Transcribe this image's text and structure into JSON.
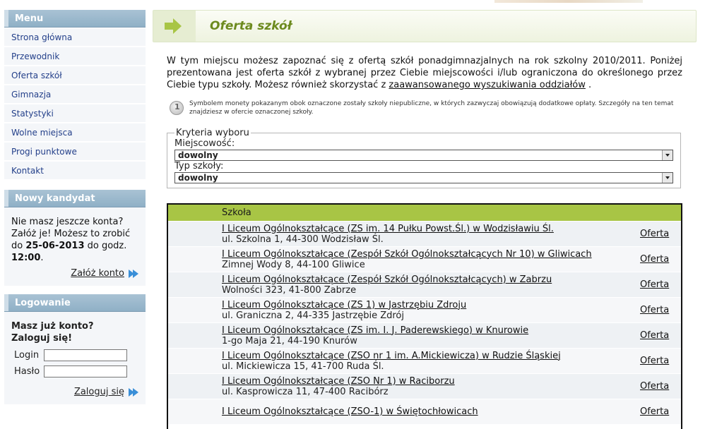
{
  "sidebar": {
    "menu_title": "Menu",
    "menu_items": [
      {
        "label": "Strona główna"
      },
      {
        "label": "Przewodnik"
      },
      {
        "label": "Oferta szkół"
      },
      {
        "label": "Gimnazja"
      },
      {
        "label": "Statystyki"
      },
      {
        "label": "Wolne miejsca"
      },
      {
        "label": "Progi punktowe"
      },
      {
        "label": "Kontakt"
      }
    ],
    "new_candidate": {
      "title": "Nowy kandydat",
      "text_1": "Nie masz jeszcze konta? Załóż je! Możesz to zrobić do ",
      "date": "25-06-2013",
      "text_2": " do godz. ",
      "time": "12:00",
      "text_3": ".",
      "link": "Załóż konto"
    },
    "login": {
      "title": "Logowanie",
      "prompt_line1": "Masz już konto?",
      "prompt_line2": "Zaloguj się!",
      "login_label": "Login",
      "password_label": "Hasło",
      "link": "Zaloguj się"
    }
  },
  "main": {
    "title": "Oferta szkół",
    "intro_text": "W tym miejscu możesz zapoznać się z ofertą szkół ponadgimnazjalnych na rok szkolny 2010/2011. Poniżej prezentowana jest oferta szkół z wybranej przez Ciebie miejscowości i/lub ograniczona do określonego przez Ciebie typu szkoły. Możesz również skorzystać z ",
    "intro_link": "zaawansowanego wyszukiwania oddziałów",
    "intro_end": " .",
    "note": "Symbolem monety pokazanym obok oznaczone zostały szkoły niepubliczne, w których zazwyczaj obowiązują dodatkowe opłaty. Szczegóły na ten temat znajdziesz w ofercie oznaczonej szkoły.",
    "criteria": {
      "legend": "Kryteria wyboru",
      "city_label": "Miejscowość:",
      "city_value": "dowolny",
      "type_label": "Typ szkoły:",
      "type_value": "dowolny"
    },
    "table": {
      "header": "Szkoła",
      "offer_label": "Oferta",
      "rows": [
        {
          "name": "I Liceum Ogólnokształcące (ZS im. 14 Pułku Powst.Śl.) w Wodzisławiu Śl.",
          "address": "ul. Szkolna 1, 44-300 Wodzisław Śl."
        },
        {
          "name": "I Liceum Ogólnokształcące (Zespół Szkół Ogólnokształcących Nr 10) w Gliwicach",
          "address": "Zimnej Wody 8, 44-100 Gliwice"
        },
        {
          "name": "I Liceum Ogólnokształcące (Zespół Szkół Ogólnokształcących) w Zabrzu",
          "address": "Wolności 323, 41-800 Zabrze"
        },
        {
          "name": "I Liceum Ogólnokształcące (ZS 1) w Jastrzębiu Zdroju",
          "address": "ul. Graniczna 2, 44-335 Jastrzębie Zdrój"
        },
        {
          "name": "I Liceum Ogólnokształcące (ZS im. I. J. Paderewskiego) w Knurowie",
          "address": "1-go Maja 21, 44-190 Knurów"
        },
        {
          "name": "I Liceum Ogólnokształcące (ZSO nr 1 im. A.Mickiewicza) w Rudzie Śląskiej",
          "address": "ul. Mickiewicza 15, 41-700 Ruda Śl."
        },
        {
          "name": "I Liceum Ogólnokształcące (ZSO Nr 1) w Raciborzu",
          "address": "ul. Kasprowicza 11, 47-400 Racibórz"
        },
        {
          "name": "I Liceum Ogólnokształcące (ZSO-1) w Świętochłowicach",
          "address": ""
        }
      ]
    }
  }
}
